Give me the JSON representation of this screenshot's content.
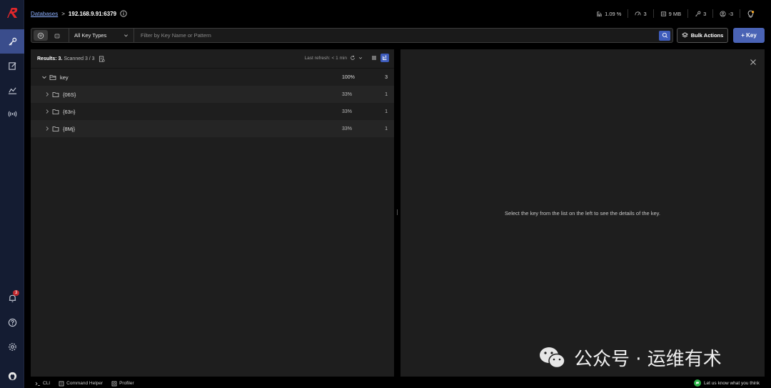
{
  "breadcrumb": {
    "databases_label": "Databases",
    "separator": ">",
    "host": "192.168.9.91:6379"
  },
  "stats": [
    {
      "icon": "cpu-icon",
      "value": "1.09 %"
    },
    {
      "icon": "gauge-icon",
      "value": "3"
    },
    {
      "icon": "memory-icon",
      "value": "9 MB"
    },
    {
      "icon": "key-icon",
      "value": "3"
    },
    {
      "icon": "clients-icon",
      "value": "-3"
    }
  ],
  "filter": {
    "type_label": "All Key Types",
    "placeholder": "Filter by Key Name or Pattern"
  },
  "actions": {
    "bulk_label": "Bulk Actions",
    "add_key_label": "+ Key"
  },
  "results": {
    "label": "Results: 3.",
    "scanned": "Scanned 3 / 3",
    "last_refresh": "Last refresh: < 1 min"
  },
  "tree": [
    {
      "name": "key",
      "percent": "100%",
      "count": "3",
      "root": true
    },
    {
      "name": "{06S}",
      "percent": "33%",
      "count": "1"
    },
    {
      "name": "{63n}",
      "percent": "33%",
      "count": "1"
    },
    {
      "name": "{8Mj}",
      "percent": "33%",
      "count": "1"
    }
  ],
  "details": {
    "empty_message": "Select the key from the list on the left to see the details of the key."
  },
  "watermark": {
    "text": "公众号 · 运维有术"
  },
  "sidebar": {
    "notification_count": "3"
  },
  "bottombar": {
    "cli_label": "CLI",
    "command_helper_label": "Command Helper",
    "profiler_label": "Profiler",
    "feedback_label": "Let us know what you think"
  },
  "colors": {
    "accent": "#3e5cbb",
    "brand_red": "#e0272b",
    "panel": "#1e1e1e",
    "sidebar": "#141c32"
  }
}
